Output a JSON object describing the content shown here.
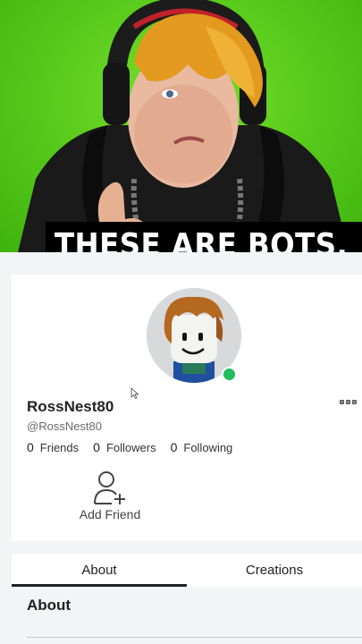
{
  "overlay": {
    "caption": "THESE ARE BOTS."
  },
  "profile": {
    "username": "RossNest80",
    "handle": "@RossNest80",
    "online": true,
    "stats": [
      {
        "count": "0",
        "label": "Friends"
      },
      {
        "count": "0",
        "label": "Followers"
      },
      {
        "count": "0",
        "label": "Following"
      }
    ],
    "add_friend_label": "Add Friend",
    "more_icon": "more-options-icon"
  },
  "tabs": [
    {
      "label": "About",
      "active": true
    },
    {
      "label": "Creations",
      "active": false
    }
  ],
  "about": {
    "heading": "About"
  },
  "colors": {
    "green_screen": "#55c91a",
    "online_status": "#1fbd5b",
    "card_bg": "#ffffff",
    "page_bg": "#f2f4f5"
  }
}
